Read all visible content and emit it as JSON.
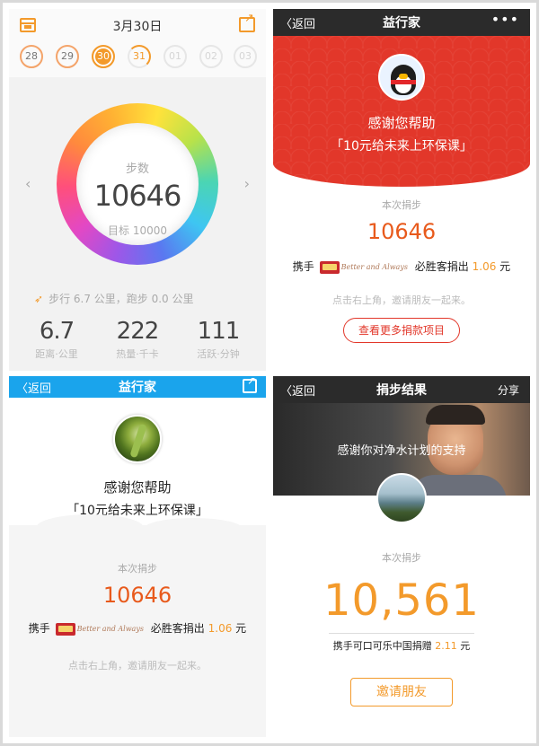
{
  "step_app": {
    "date": "3月30日",
    "days": [
      "28",
      "29",
      "30",
      "31",
      "01",
      "02",
      "03"
    ],
    "ring_label": "步数",
    "steps": "10646",
    "goal": "目标 10000",
    "walk_summary": "步行 6.7 公里，跑步 0.0 公里",
    "stats": [
      {
        "value": "6.7",
        "label": "距离·公里"
      },
      {
        "value": "222",
        "label": "热量·千卡"
      },
      {
        "value": "111",
        "label": "活跃·分钟"
      }
    ],
    "colors": {
      "accent": "#f39a2b"
    }
  },
  "red_panel": {
    "back_label": "返回",
    "title": "益行家",
    "thanks": "感谢您帮助",
    "project": "「10元给未来上环保课」",
    "donation_label": "本次捐步",
    "steps": "10646",
    "sponsor_prefix": "携手",
    "sponsor_script": "Better and Always",
    "sponsor_suffix": "必胜客捐出",
    "amount": "1.06",
    "unit": "元",
    "hint": "点击右上角，邀请朋友一起来。",
    "more_button": "查看更多捐款项目",
    "colors": {
      "brand": "#e2372a"
    }
  },
  "blue_panel": {
    "back_label": "返回",
    "title": "益行家",
    "thanks": "感谢您帮助",
    "project": "「10元给未来上环保课」",
    "donation_label": "本次捐步",
    "steps": "10646",
    "sponsor_prefix": "携手",
    "sponsor_script": "Better and Always",
    "sponsor_suffix": "必胜客捐出",
    "amount": "1.06",
    "unit": "元",
    "hint": "点击右上角，邀请朋友一起来。",
    "colors": {
      "nav": "#1aa4ec"
    }
  },
  "result_panel": {
    "back_label": "返回",
    "title": "捐步结果",
    "share_label": "分享",
    "hero_text": "感谢你对净水计划的支持",
    "donation_label": "本次捐步",
    "steps": "10,561",
    "sponsor_text": "携手可口可乐中国捐赠",
    "amount": "2.11",
    "unit": "元",
    "invite_button": "邀请朋友"
  }
}
